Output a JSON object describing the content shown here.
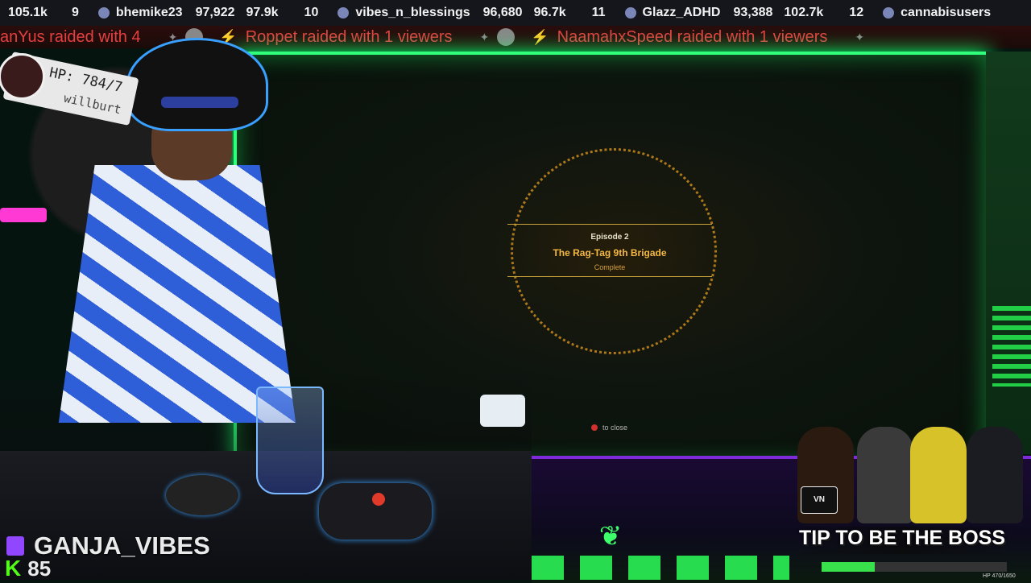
{
  "leaderboard": {
    "lead_text": "105.1k",
    "entries": [
      {
        "rank": "9",
        "name": "bhemike23",
        "score": "97,922",
        "total": "97.9k"
      },
      {
        "rank": "10",
        "name": "vibes_n_blessings",
        "score": "96,680",
        "total": "96.7k"
      },
      {
        "rank": "11",
        "name": "Glazz_ADHD",
        "score": "93,388",
        "total": "102.7k"
      },
      {
        "rank": "12",
        "name": "cannabisusers",
        "score": "",
        "total": ""
      }
    ]
  },
  "raid_ticker": {
    "items": [
      "anYus raided with 4",
      "Roppet raided with 1 viewers",
      "NaamahxSpeed raided with 1 viewers"
    ]
  },
  "hp_panel": {
    "hp": "HP: 784/7",
    "name": "willburt"
  },
  "game": {
    "episode_label": "Episode 2",
    "episode_title": "The Rag-Tag 9th Brigade",
    "episode_status": "Complete",
    "close_hint": "to close"
  },
  "channel": {
    "name": "GANJA_VIBES",
    "kick_count": "85"
  },
  "hype": {
    "logo": "VN",
    "tip_label": "TIP TO BE THE BOSS",
    "hp_text": "HP 470/1650",
    "hp_fraction": 0.285
  },
  "colors": {
    "frame_green": "#2fff7a",
    "accent_purple": "#7d2bd9",
    "episode_gold": "#f3b843",
    "raid_red": "#e54040"
  }
}
